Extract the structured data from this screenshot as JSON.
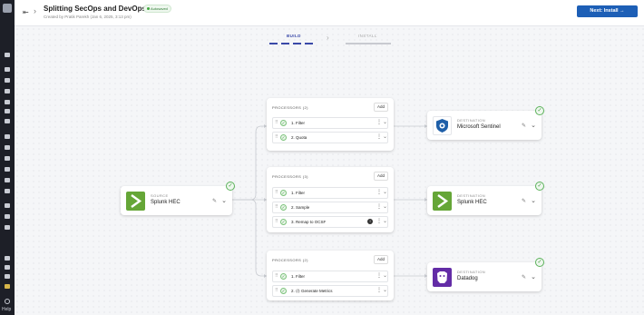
{
  "header": {
    "title": "Splitting SecOps and DevOps logs",
    "status_badge": "Autosaved",
    "subtitle": "Created by Pratik Parekh (Jan 6, 2025, 3:13 pm)",
    "next_button": "Next: Install →"
  },
  "steps": {
    "build": "BUILD",
    "install": "INSTALL"
  },
  "sidebar": {
    "help_label": "Help"
  },
  "source": {
    "label": "SOURCE",
    "name": "Splunk HEC",
    "logo_color": "#65a637"
  },
  "processor_groups": [
    {
      "header": "PROCESSORS (2)",
      "add_label": "Add",
      "rows": [
        {
          "text": "1.   Filter"
        },
        {
          "text": "2.   Quota"
        }
      ]
    },
    {
      "header": "PROCESSORS (3)",
      "add_label": "Add",
      "rows": [
        {
          "text": "1.   Filter"
        },
        {
          "text": "2.   Sample"
        },
        {
          "text": "3.   Remap to OCSF"
        }
      ]
    },
    {
      "header": "PROCESSORS (2)",
      "add_label": "Add",
      "rows": [
        {
          "text": "1.   Filter"
        },
        {
          "text": "2.   ⟨/⟩  Generate Metrics"
        }
      ]
    }
  ],
  "destinations": [
    {
      "label": "DESTINATION",
      "name": "Microsoft Sentinel",
      "logo_color": "#1f5fa8"
    },
    {
      "label": "DESTINATION",
      "name": "Splunk HEC",
      "logo_color": "#65a637"
    },
    {
      "label": "DESTINATION",
      "name": "Datadog",
      "logo_color": "#632ca6"
    }
  ],
  "colors": {
    "accent": "#1d5fb6",
    "build_step": "#3a49a8",
    "success": "#41a83e"
  }
}
